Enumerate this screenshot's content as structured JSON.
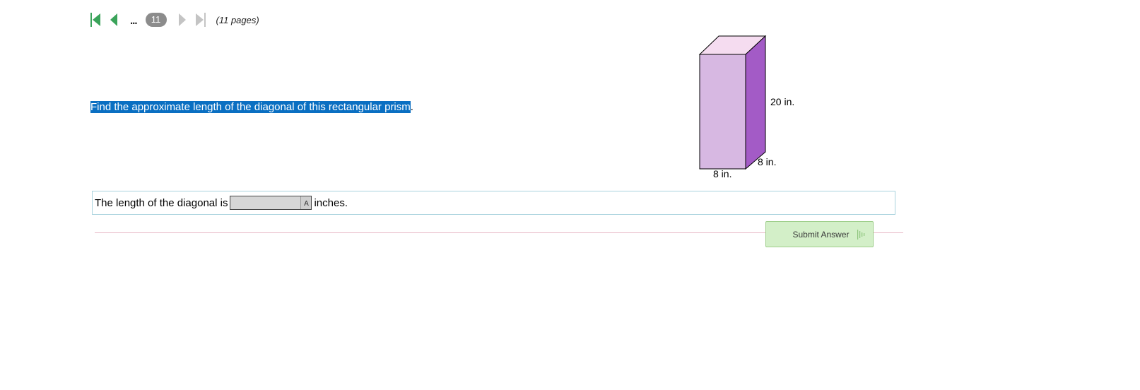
{
  "pager": {
    "current_page": "11",
    "ellipsis": "...",
    "total_pages_text": "(11 pages)"
  },
  "question": {
    "text": "Find the approximate length of the diagonal of this rectangular prism",
    "trailing_punctuation": "."
  },
  "figure": {
    "height_label": "20 in.",
    "depth_label": "8 in.",
    "width_label": "8 in.",
    "colors": {
      "front_face": "#d7b8e2",
      "side_face": "#a35bc6",
      "top_face": "#f5dcf0",
      "edge": "#000000"
    }
  },
  "answer": {
    "prefix": "The length of the diagonal is",
    "value": "",
    "palette_glyph": "A",
    "suffix": "inches."
  },
  "submit": {
    "label": "Submit Answer"
  },
  "colors": {
    "pager_active": "#3aa35a",
    "pager_disabled": "#c4c4c4",
    "highlight": "#0a6fc2",
    "submit_bg": "#d3efc8",
    "answer_border": "#a9d3de",
    "divider": "#e7b6c4"
  }
}
